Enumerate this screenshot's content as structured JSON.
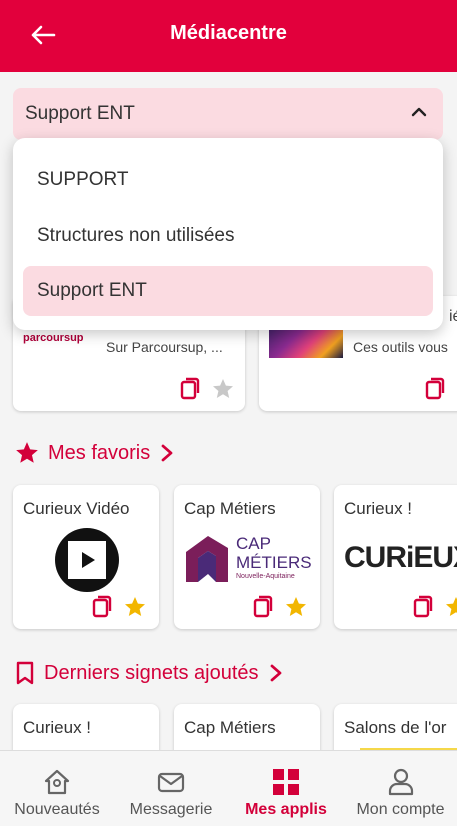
{
  "header": {
    "title": "Médiacentre"
  },
  "select": {
    "value": "Support ENT"
  },
  "dropdown": {
    "options": [
      {
        "label": "SUPPORT"
      },
      {
        "label": "Structures non utilisées"
      },
      {
        "label": "Support ENT"
      }
    ],
    "selected_index": 2
  },
  "top_cards": [
    {
      "logo_text": "parcoursup",
      "text": "Sur Parcoursup, ...",
      "favorite": false
    },
    {
      "title_fragment": "ié",
      "text": "Ces outils vous"
    }
  ],
  "favorites": {
    "title": "Mes favoris",
    "items": [
      {
        "title": "Curieux Vidéo",
        "favorite": true
      },
      {
        "title": "Cap Métiers",
        "logo_line1": "CAP",
        "logo_line2": "MÉTIERS",
        "logo_line3": "Nouvelle-Aquitaine",
        "favorite": true
      },
      {
        "title": "Curieux !",
        "logo_text": "CURiEUX",
        "favorite": true
      }
    ]
  },
  "bookmarks": {
    "title": "Derniers signets ajoutés",
    "items": [
      {
        "title": "Curieux !"
      },
      {
        "title": "Cap Métiers"
      },
      {
        "title": "Salons de l'or"
      }
    ]
  },
  "nav": {
    "items": [
      {
        "label": "Nouveautés",
        "icon": "home-icon"
      },
      {
        "label": "Messagerie",
        "icon": "mail-icon"
      },
      {
        "label": "Mes applis",
        "icon": "apps-grid-icon",
        "active": true
      },
      {
        "label": "Mon compte",
        "icon": "user-icon"
      }
    ]
  },
  "colors": {
    "brand": "#e2003c",
    "accent_text": "#d3003a",
    "selected_bg": "#fbdbe1",
    "star_gold": "#f2b600"
  }
}
